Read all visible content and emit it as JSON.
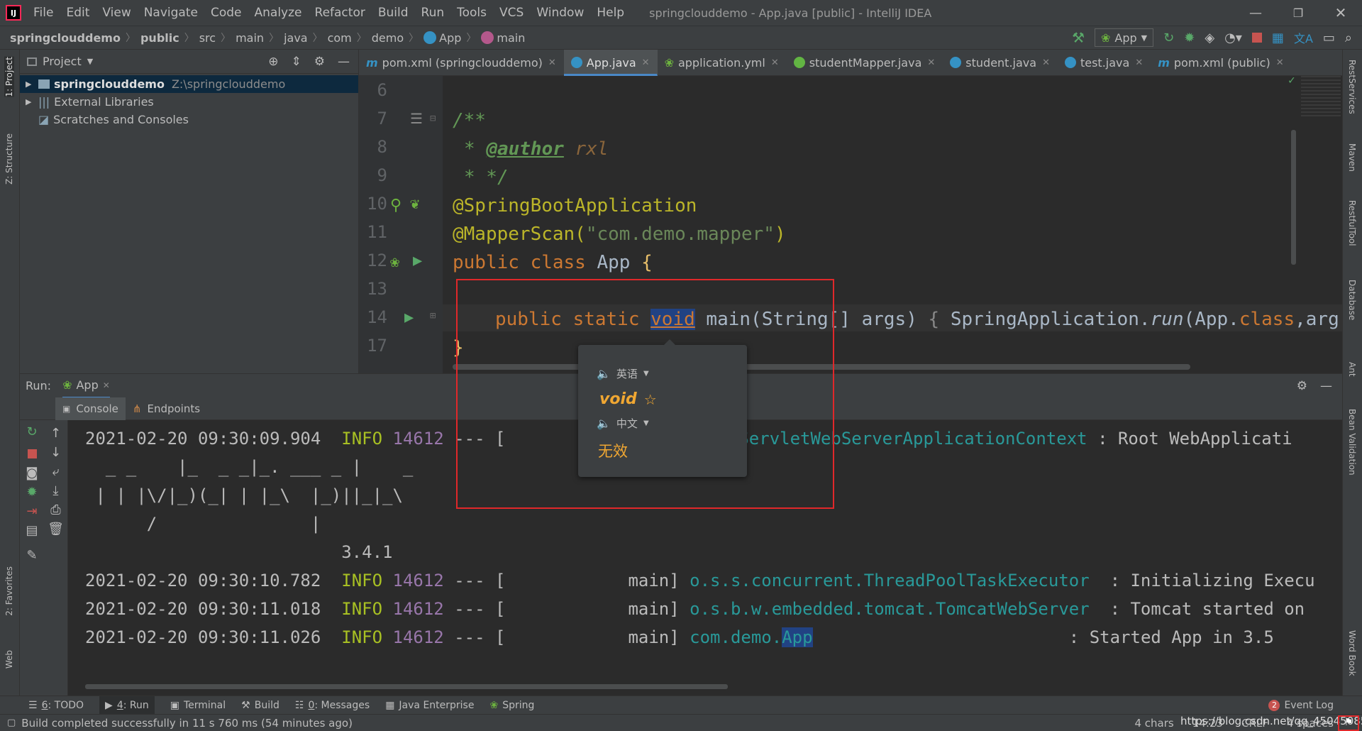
{
  "menu": {
    "items": [
      "File",
      "Edit",
      "View",
      "Navigate",
      "Code",
      "Analyze",
      "Refactor",
      "Build",
      "Run",
      "Tools",
      "VCS",
      "Window",
      "Help"
    ],
    "title": "springclouddemo - App.java [public] - IntelliJ IDEA"
  },
  "nav": {
    "breadcrumbs": [
      "springclouddemo",
      "public",
      "src",
      "main",
      "java",
      "com",
      "demo",
      "App",
      "main"
    ],
    "run_config": "App"
  },
  "left_strip": {
    "project": "1: Project",
    "structure": "Z: Structure",
    "favorites": "2: Favorites",
    "web": "Web"
  },
  "right_strip": {
    "rest": "RestServices",
    "maven": "Maven",
    "restful": "RestfulTool",
    "database": "Database",
    "ant": "Ant",
    "bean": "Bean Validation",
    "word": "Word Book"
  },
  "project": {
    "title": "Project",
    "tree": [
      {
        "label": "springclouddemo",
        "path": "Z:\\springclouddemo"
      },
      {
        "label": "External Libraries",
        "path": ""
      },
      {
        "label": "Scratches and Consoles",
        "path": ""
      }
    ]
  },
  "editor": {
    "tabs": [
      "pom.xml (springclouddemo)",
      "App.java",
      "application.yml",
      "studentMapper.java",
      "student.java",
      "test.java",
      "pom.xml (public)"
    ],
    "lines": [
      {
        "num": "6"
      },
      {
        "num": "7",
        "text": "/**"
      },
      {
        "num": "8",
        "star": "* ",
        "tag": "@author",
        "rest": " rxl"
      },
      {
        "num": "9",
        "text": "* */"
      },
      {
        "num": "10",
        "text": "@SpringBootApplication"
      },
      {
        "num": "11",
        "ann": "@MapperScan(",
        "str": "\"com.demo.mapper\"",
        "end": ")"
      },
      {
        "num": "12",
        "kw": "public class ",
        "name": "App ",
        "brace": "{"
      },
      {
        "num": "13"
      },
      {
        "num": "14",
        "kw1": "public static ",
        "kw2": "void",
        "name": " main(String[] args) ",
        "b1": "{ ",
        "call": "SpringApplication.",
        "method": "run",
        "args": "(App.",
        "cls": "class",
        "tail": ",arg"
      },
      {
        "num": "17",
        "text": "}"
      }
    ]
  },
  "run": {
    "label": "Run:",
    "config": "App",
    "tabs": [
      "Console",
      "Endpoints"
    ],
    "lines": [
      {
        "ts": "2021-02-20 09:30:09.904",
        "level": "INFO",
        "pid": "14612",
        "sep": " --- [",
        "thread": "",
        "logger": "c.ServletWebServerApplicationContext",
        "msg": " : Root WebApplicati"
      },
      {
        "raw": "  _ _    |_  _ _|_. ___ _ |    _"
      },
      {
        "raw": " | | |\\/|_)(_| | |_\\  |_)||_|_\\"
      },
      {
        "raw": "      /               |"
      },
      {
        "raw": "                         3.4.1"
      },
      {
        "ts": "2021-02-20 09:30:10.782",
        "level": "INFO",
        "pid": "14612",
        "sep": " --- [",
        "thread": "main] ",
        "logger": "o.s.s.concurrent.ThreadPoolTaskExecutor",
        "msg": "  : Initializing Execu"
      },
      {
        "ts": "2021-02-20 09:30:11.018",
        "level": "INFO",
        "pid": "14612",
        "sep": " --- [",
        "thread": "main] ",
        "logger": "o.s.b.w.embedded.tomcat.TomcatWebServer",
        "msg": "  : Tomcat started on"
      },
      {
        "ts": "2021-02-20 09:30:11.026",
        "level": "INFO",
        "pid": "14612",
        "sep": " --- [",
        "thread": "main] ",
        "logger_a": "com.demo.",
        "logger_b": "App",
        "msg": "                         : Started App in 3.5"
      }
    ]
  },
  "popup": {
    "source_lang": "英语",
    "word": "void",
    "target_lang": "中文",
    "translation": "无效"
  },
  "bottom_tabs": [
    {
      "mn": "6",
      "rest": ": TODO"
    },
    {
      "mn": "4",
      "rest": ": Run"
    },
    {
      "mn": "",
      "rest": "Terminal"
    },
    {
      "mn": "",
      "rest": "Build"
    },
    {
      "mn": "0",
      "rest": ": Messages"
    },
    {
      "mn": "",
      "rest": "Java Enterprise"
    },
    {
      "mn": "",
      "rest": "Spring"
    }
  ],
  "event_log": {
    "count": "2",
    "label": "Event Log"
  },
  "status": {
    "message": "Build completed successfully in 11 s 760 ms (54 minutes ago)",
    "chars": "4 chars",
    "position": "14:23",
    "line_sep": "CRLF",
    "indent": "4 spaces",
    "watermark": "https://blog.csdn.net/qq_45045085"
  },
  "colors": {
    "accent": "#4a88c7",
    "highlight_box": "#e0282a",
    "popup_word": "#f0a732"
  }
}
